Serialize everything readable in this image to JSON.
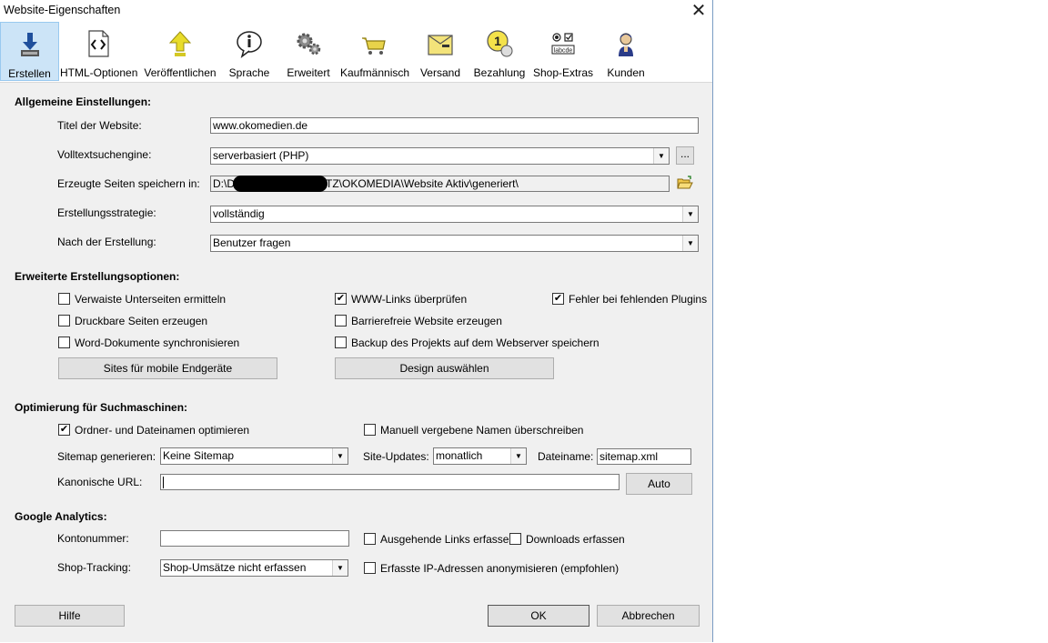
{
  "window": {
    "title": "Website-Eigenschaften"
  },
  "toolbar": {
    "items": [
      {
        "label": "Erstellen",
        "icon": "download-create-icon",
        "active": true
      },
      {
        "label": "HTML-Optionen",
        "icon": "html-code-icon"
      },
      {
        "label": "Veröffentlichen",
        "icon": "upload-arrow-icon"
      },
      {
        "label": "Sprache",
        "icon": "info-speech-icon"
      },
      {
        "label": "Erweitert",
        "icon": "gears-icon"
      },
      {
        "label": "Kaufmännisch",
        "icon": "shopping-cart-icon"
      },
      {
        "label": "Versand",
        "icon": "shipping-box-icon"
      },
      {
        "label": "Bezahlung",
        "icon": "payment-coin-icon"
      },
      {
        "label": "Shop-Extras",
        "icon": "form-controls-icon"
      },
      {
        "label": "Kunden",
        "icon": "customer-person-icon"
      }
    ]
  },
  "general": {
    "heading": "Allgemeine Einstellungen:",
    "title_label": "Titel der Website:",
    "title_value": "www.okomedien.de",
    "search_label": "Volltextsuchengine:",
    "search_value": "serverbasiert (PHP)",
    "more_button": "...",
    "path_label": "Erzeugte Seiten speichern in:",
    "path_prefix": "D:\\D",
    "path_suffix": "TZ\\OKOMEDIA\\Website Aktiv\\generiert\\",
    "strategy_label": "Erstellungsstrategie:",
    "strategy_value": "vollständig",
    "after_label": "Nach der Erstellung:",
    "after_value": "Benutzer fragen"
  },
  "extended": {
    "heading": "Erweiterte Erstellungsoptionen:",
    "checkboxes": [
      {
        "label": "Verwaiste Unterseiten ermitteln",
        "checked": false
      },
      {
        "label": "WWW-Links überprüfen",
        "checked": true
      },
      {
        "label": "Fehler bei fehlenden Plugins",
        "checked": true
      },
      {
        "label": "Druckbare Seiten erzeugen",
        "checked": false
      },
      {
        "label": "Barrierefreie Website erzeugen",
        "checked": false
      },
      {
        "label": "Word-Dokumente synchronisieren",
        "checked": false
      },
      {
        "label": "Backup des Projekts auf dem Webserver speichern",
        "checked": false
      }
    ],
    "mobile_button": "Sites für mobile Endgeräte",
    "design_button": "Design auswählen"
  },
  "seo": {
    "heading": "Optimierung für Suchmaschinen:",
    "opt_names": {
      "label": "Ordner- und Dateinamen optimieren",
      "checked": true
    },
    "override": {
      "label": "Manuell vergebene Namen überschreiben",
      "checked": false
    },
    "sitemap_label": "Sitemap generieren:",
    "sitemap_value": "Keine Sitemap",
    "updates_label": "Site-Updates:",
    "updates_value": "monatlich",
    "filename_label": "Dateiname:",
    "filename_value": "sitemap.xml",
    "canonical_label": "Kanonische URL:",
    "canonical_value": "",
    "auto_button": "Auto"
  },
  "analytics": {
    "heading": "Google Analytics:",
    "account_label": "Kontonummer:",
    "account_value": "",
    "outgoing": {
      "label": "Ausgehende Links erfassen",
      "checked": false
    },
    "downloads": {
      "label": "Downloads erfassen",
      "checked": false
    },
    "shop_label": "Shop-Tracking:",
    "shop_value": "Shop-Umsätze nicht erfassen",
    "anonymize": {
      "label": "Erfasste IP-Adressen anonymisieren (empfohlen)",
      "checked": false
    }
  },
  "footer": {
    "help": "Hilfe",
    "ok": "OK",
    "cancel": "Abbrechen"
  }
}
